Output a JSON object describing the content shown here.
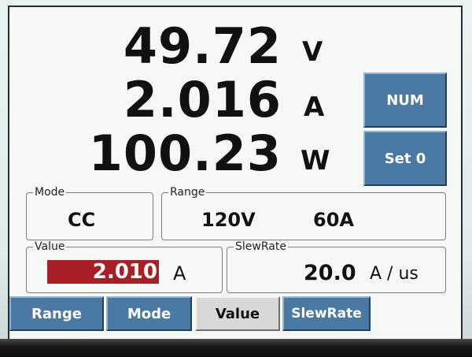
{
  "readings": {
    "voltage": {
      "value": "49.72",
      "unit": "V"
    },
    "current": {
      "value": "2.016",
      "unit": "A"
    },
    "power": {
      "value": "100.23",
      "unit": "W"
    }
  },
  "side_buttons": {
    "num": "NUM",
    "set0": "Set 0"
  },
  "mode_box": {
    "label": "Mode",
    "value": "CC"
  },
  "range_box": {
    "label": "Range",
    "voltage": "120V",
    "current": "60A"
  },
  "value_box": {
    "label": "Value",
    "value": "2.010",
    "unit": "A"
  },
  "slewrate_box": {
    "label": "SlewRate",
    "value": "20.0",
    "unit": "A / us"
  },
  "tabs": {
    "range": "Range",
    "mode": "Mode",
    "value": "Value",
    "slewrate": "SlewRate"
  },
  "colors": {
    "button_blue": "#4a79a3",
    "value_highlight": "#a82026"
  }
}
